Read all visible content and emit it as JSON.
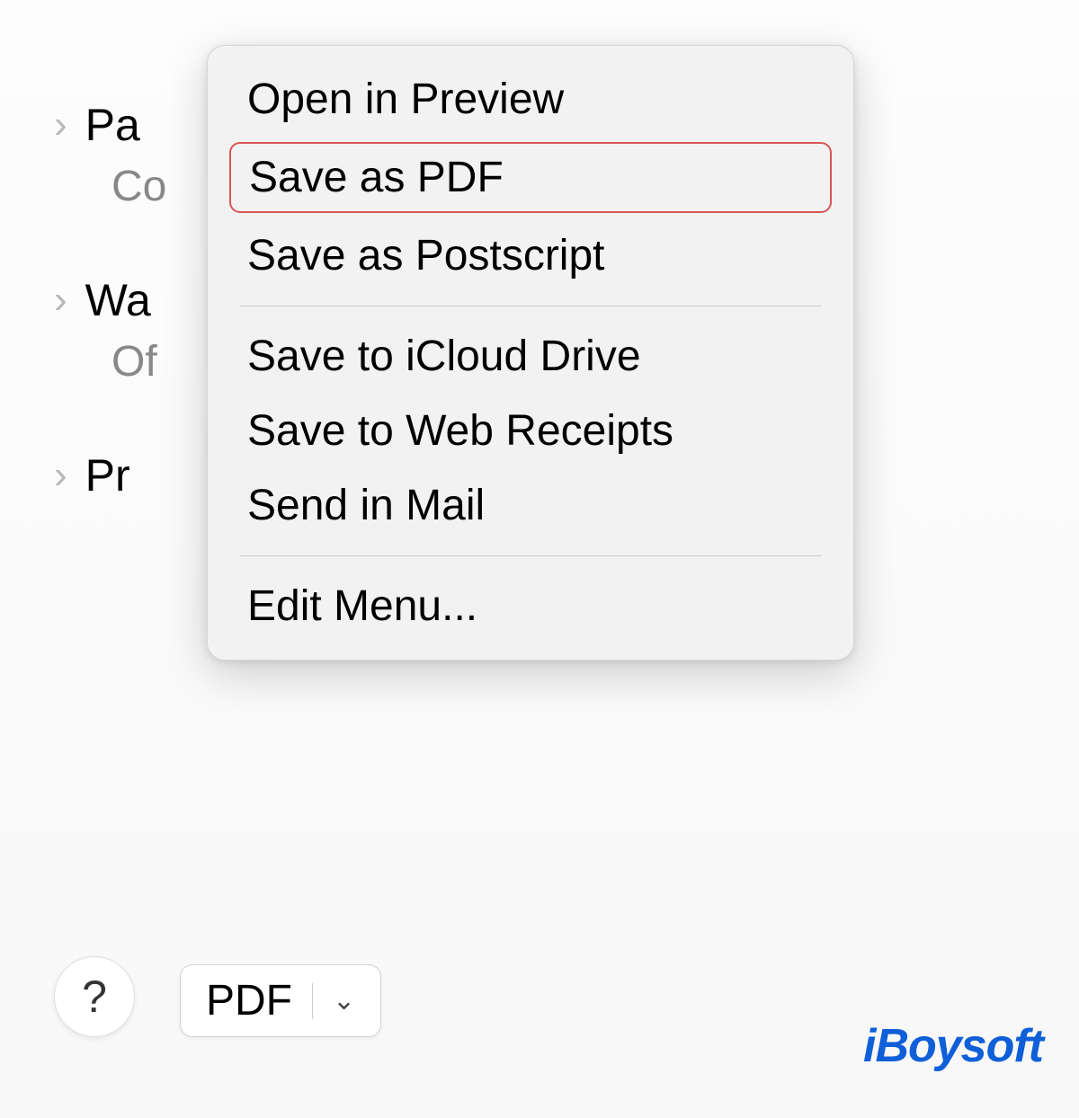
{
  "background": {
    "rows": [
      {
        "primary": "Pa",
        "secondary": "Co",
        "hasChevron": true
      },
      {
        "primary": "Wa",
        "secondary": "Of",
        "hasChevron": true
      },
      {
        "primary": "Pr",
        "secondary": "",
        "hasChevron": true
      }
    ]
  },
  "helpButton": {
    "label": "?"
  },
  "pdfButton": {
    "label": "PDF"
  },
  "menu": {
    "groups": [
      [
        {
          "label": "Open in Preview",
          "highlighted": false
        },
        {
          "label": "Save as PDF",
          "highlighted": true
        },
        {
          "label": "Save as Postscript",
          "highlighted": false
        }
      ],
      [
        {
          "label": "Save to iCloud Drive",
          "highlighted": false
        },
        {
          "label": "Save to Web Receipts",
          "highlighted": false
        },
        {
          "label": "Send in Mail",
          "highlighted": false
        }
      ],
      [
        {
          "label": "Edit Menu...",
          "highlighted": false
        }
      ]
    ]
  },
  "watermark": {
    "text": "iBoysoft"
  }
}
